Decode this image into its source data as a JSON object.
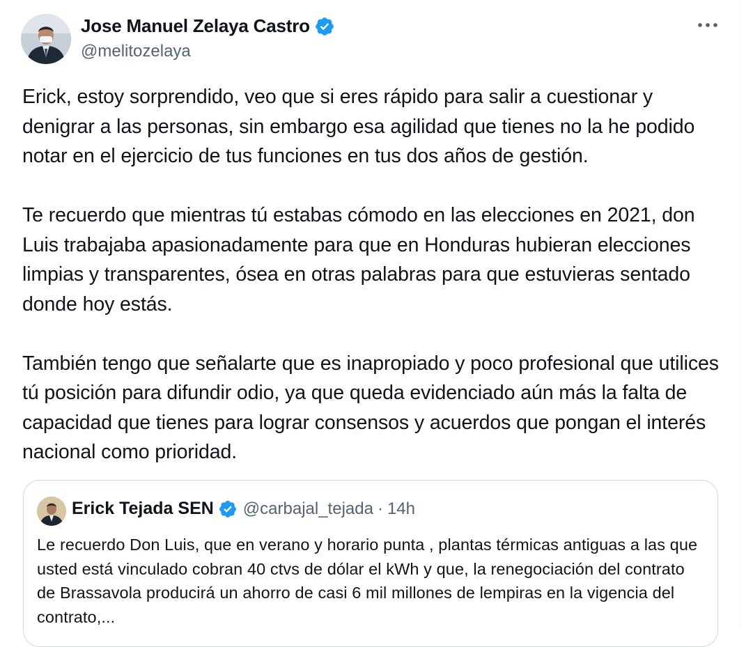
{
  "author": {
    "name": "Jose Manuel Zelaya Castro",
    "handle": "@melitozelaya",
    "verified_color": "#1d9bf0",
    "avatar_icon": "profile-photo"
  },
  "menu": {
    "more_icon": "ellipsis-icon"
  },
  "tweet": {
    "paragraphs": [
      "Erick, estoy sorprendido, veo que si eres rápido para salir a cuestionar y denigrar a las personas, sin embargo esa agilidad que tienes no la he podido notar en el ejercicio de tus funciones en tus dos años de gestión.",
      "Te recuerdo que mientras tú estabas cómodo en las elecciones en 2021, don Luis trabajaba apasionadamente para que en Honduras hubieran elecciones limpias y transparentes, ósea en otras palabras para que estuvieras sentado donde hoy estás.",
      "También tengo que señalarte que es inapropiado y poco profesional que utilices tú posición para difundir odio, ya que queda evidenciado aún más la falta de capacidad que tienes para lograr consensos y acuerdos que pongan el interés nacional como prioridad."
    ]
  },
  "quote": {
    "name": "Erick Tejada SEN",
    "handle": "@carbajal_tejada",
    "separator": "·",
    "time": "14h",
    "text": "Le recuerdo Don Luis, que en verano y horario punta , plantas térmicas antiguas  a las que usted está vinculado cobran 40 ctvs de dólar el kWh  y que, la renegociación del contrato de Brassavola producirá un ahorro de casi 6 mil millones de lempiras en la vigencia del contrato,..."
  },
  "colors": {
    "text": "#0f1419",
    "secondary": "#536471",
    "border": "#cfd9de",
    "verified": "#1d9bf0"
  }
}
